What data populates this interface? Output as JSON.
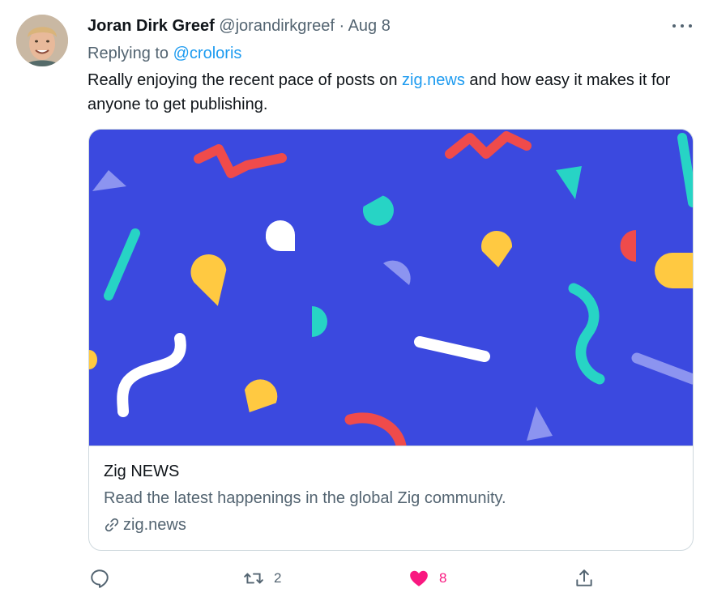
{
  "tweet": {
    "author_name": "Joran Dirk Greef",
    "handle": "@jorandirkgreef",
    "separator": "·",
    "date": "Aug 8",
    "replying_prefix": "Replying to",
    "replying_to": "@croloris",
    "text_before_link": "Really enjoying the recent pace of posts on ",
    "text_link": "zig.news",
    "text_after_link": " and how easy it makes it for anyone to get publishing."
  },
  "card": {
    "title": "Zig NEWS",
    "description": "Read the latest happenings in the global Zig community.",
    "domain": "zig.news",
    "background_color": "#3b49df"
  },
  "actions": {
    "reply_icon": "reply-icon",
    "retweet_count": "2",
    "like_count": "8",
    "like_active": true,
    "share_icon": "share-icon"
  },
  "colors": {
    "link": "#1d9bf0",
    "secondary_text": "#536471",
    "like": "#f91880",
    "border": "#cfd9de"
  }
}
